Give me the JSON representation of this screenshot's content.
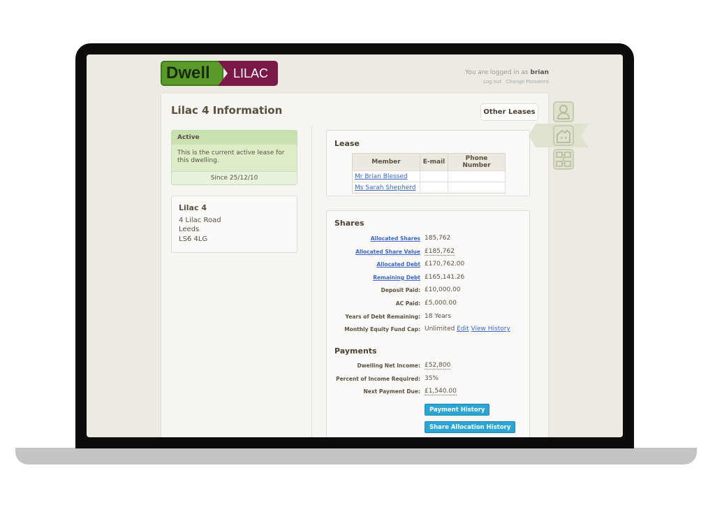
{
  "logo": {
    "brand": "Dwell",
    "site": "LILAC"
  },
  "user": {
    "prefix": "You are logged in as",
    "name": "brian",
    "logout": "Log out",
    "change_password": "Change Password"
  },
  "page": {
    "title": "Lilac 4 Information",
    "other_leases": "Other Leases"
  },
  "status": {
    "label": "Active",
    "text": "This is the current active lease for this dwelling.",
    "since": "Since 25/12/10"
  },
  "address": {
    "name": "Lilac 4",
    "line1": "4 Lilac Road",
    "city": "Leeds",
    "postcode": "LS6 4LG"
  },
  "lease": {
    "title": "Lease",
    "columns": [
      "Member",
      "E-mail",
      "Phone Number"
    ],
    "rows": [
      [
        "Mr Brian Blessed",
        "",
        ""
      ],
      [
        "Ms Sarah Shepherd",
        "",
        ""
      ]
    ]
  },
  "shares": {
    "title": "Shares",
    "rows": [
      {
        "label": "Allocated Shares",
        "value": "185,762"
      },
      {
        "label": "Allocated Share Value",
        "value": "£185,762"
      },
      {
        "label": "Allocated Debt",
        "value": "£170,762.00"
      },
      {
        "label": "Remaining Debt",
        "value": "£165,141.26"
      },
      {
        "label": "Deposit Paid:",
        "value": "£10,000.00"
      },
      {
        "label": "AC Paid:",
        "value": "£5,000.00"
      },
      {
        "label": "Years of Debt Remaining:",
        "value": "18 Years"
      },
      {
        "label": "Monthly Equity Fund Cap:",
        "value": "Unlimited",
        "edit": "Edit",
        "history": "View History"
      }
    ]
  },
  "payments": {
    "title": "Payments",
    "rows": [
      {
        "label": "Dwelling Net Income:",
        "value": "£52,800"
      },
      {
        "label": "Percent of Income Required:",
        "value": "35%"
      },
      {
        "label": "Next Payment Due:",
        "value": "£1,540.00"
      }
    ],
    "payment_history": "Payment History",
    "share_history": "Share Allocation History"
  },
  "nav": {
    "icons": [
      "person-icon",
      "house-icon",
      "building-icon"
    ],
    "active": "house-icon"
  }
}
